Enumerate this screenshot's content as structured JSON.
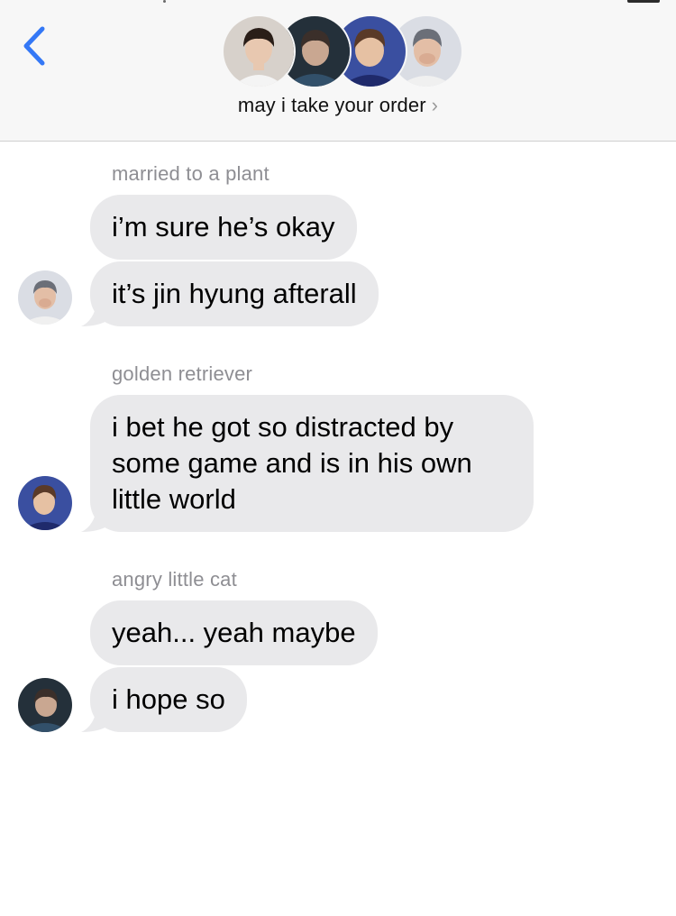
{
  "header": {
    "title": "may i take your order",
    "chevron": "›",
    "back_icon": "chevron-left-icon",
    "accent_color": "#3478f6"
  },
  "participants": [
    {
      "name": "member-1",
      "avatar_colors": {
        "bg": "#d7d1cb",
        "skin": "#e8c8b0",
        "hair": "#2a1e18",
        "shirt": "#f4f4f4"
      }
    },
    {
      "name": "member-2",
      "avatar_colors": {
        "bg": "#24303a",
        "skin": "#c9a791",
        "hair": "#3b2f2a",
        "shirt": "#32506a"
      }
    },
    {
      "name": "member-3",
      "avatar_colors": {
        "bg": "#3a4fa0",
        "skin": "#e6c1a3",
        "hair": "#5a3a28",
        "shirt": "#1f2a6b"
      }
    },
    {
      "name": "member-4",
      "avatar_colors": {
        "bg": "#dadde4",
        "skin": "#e3bea6",
        "hair": "#6b6f78",
        "shirt": "#f0f0f0"
      }
    }
  ],
  "messages": [
    {
      "sender": "married to a plant",
      "lines": [
        "i’m sure he’s okay",
        "it’s jin hyung afterall"
      ]
    },
    {
      "sender": "golden retriever",
      "lines": [
        "i bet he got so distracted by some game and is in his own little world"
      ]
    },
    {
      "sender": "angry little cat",
      "lines": [
        "yeah... yeah maybe",
        "i hope so"
      ]
    }
  ],
  "colors": {
    "bubble_bg": "#e9e9eb",
    "sender_name": "#8e8e93",
    "header_bg": "#f7f7f7"
  }
}
